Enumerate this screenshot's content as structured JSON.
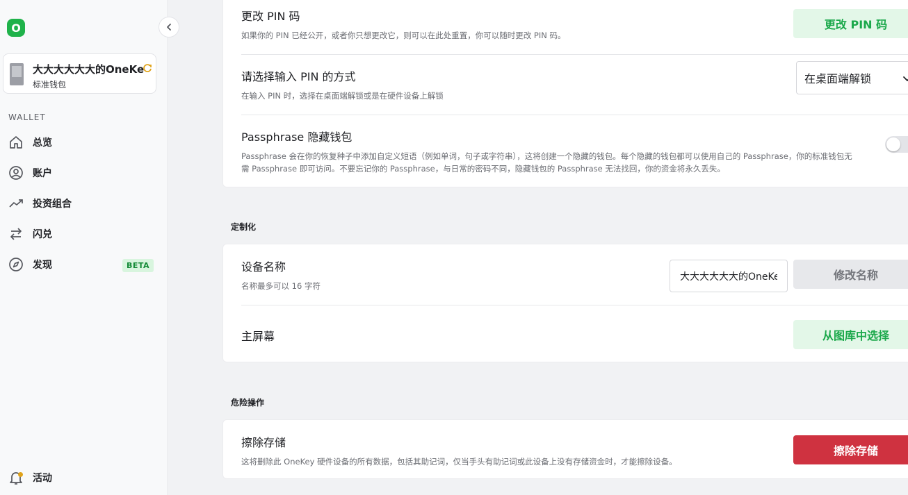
{
  "sidebar": {
    "logo_text": "O",
    "wallet": {
      "name": "大大大大大大的OneKey",
      "type": "标准钱包"
    },
    "section_label": "WALLET",
    "items": [
      {
        "label": "总览",
        "icon": "home-icon"
      },
      {
        "label": "账户",
        "icon": "user-circle-icon"
      },
      {
        "label": "投资组合",
        "icon": "trend-up-icon"
      },
      {
        "label": "闪兑",
        "icon": "swap-icon"
      },
      {
        "label": "发现",
        "icon": "compass-icon",
        "badge": "BETA"
      }
    ],
    "activity_label": "活动"
  },
  "security": {
    "pin": {
      "title": "更改 PIN 码",
      "desc": "如果你的 PIN 已经公开，或者你只想更改它，则可以在此处重置，你可以随时更改 PIN 码。",
      "button": "更改 PIN 码"
    },
    "pin_method": {
      "title": "请选择输入 PIN 的方式",
      "desc": "在输入 PIN 时，选择在桌面端解锁或是在硬件设备上解锁",
      "selected": "在桌面端解锁"
    },
    "passphrase": {
      "title": "Passphrase 隐藏钱包",
      "desc_line1": "Passphrase 会在你的恢复种子中添加自定义短语（例如单词，句子或字符串），这将创建一个隐藏的钱包。每个隐藏的钱包都可以使用自己的 Passphrase，你的标准钱包无",
      "desc_line2": "需 Passphrase 即可访问。不要忘记你的 Passphrase，与日常的密码不同，隐藏钱包的 Passphrase 无法找回，你的资金将永久丢失。",
      "enabled": false
    }
  },
  "customize": {
    "group_title": "定制化",
    "device_name": {
      "title": "设备名称",
      "desc": "名称最多可以 16 字符",
      "value": "大大大大大大的OneKey",
      "button": "修改名称"
    },
    "home_screen": {
      "title": "主屏幕",
      "button": "从图库中选择"
    }
  },
  "danger": {
    "group_title": "危险操作",
    "wipe": {
      "title": "擦除存储",
      "desc": "这将删除此 OneKey 硬件设备的所有数据，包括其助记词，仅当手头有助记词或此设备上没有存储资金时，才能擦除设备。",
      "button": "擦除存储"
    }
  },
  "colors": {
    "brand": "#1fb24a",
    "danger": "#cf3240",
    "green_button_bg": "#e3f7e8",
    "green_button_text": "#1aa84a"
  }
}
